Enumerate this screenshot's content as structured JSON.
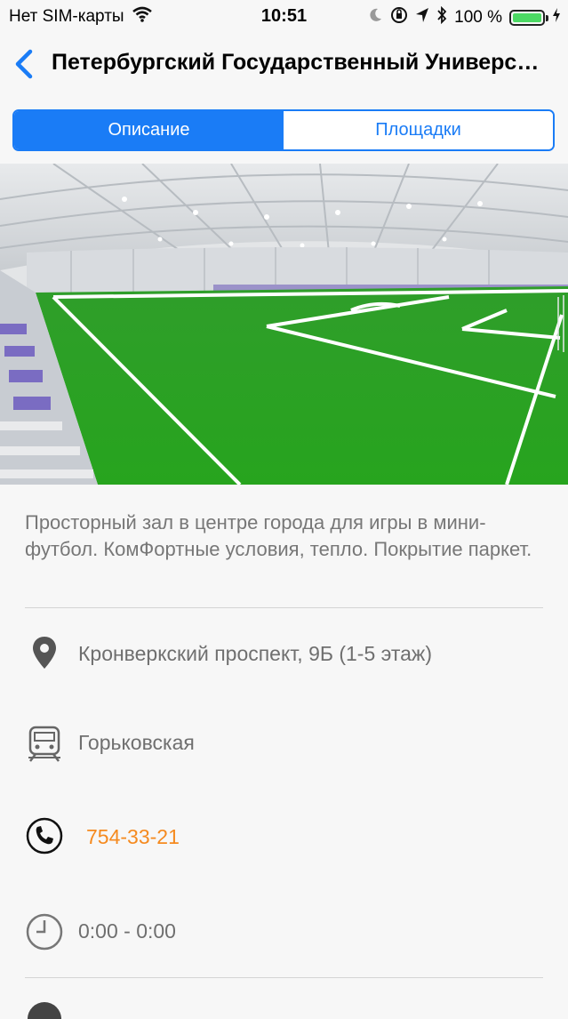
{
  "status_bar": {
    "carrier": "Нет SIM-карты",
    "time": "10:51",
    "battery": "100 %",
    "icons": [
      "wifi-icon",
      "moon-icon",
      "rotation-lock-icon",
      "location-arrow-icon",
      "bluetooth-icon",
      "battery-icon",
      "charging-icon"
    ]
  },
  "nav": {
    "title": "Петербургский Государственный Университет",
    "back_icon": "chevron-left-icon"
  },
  "tabs": [
    {
      "label": "Описание",
      "active": true
    },
    {
      "label": "Площадки",
      "active": false
    }
  ],
  "venue": {
    "description": "Просторный зал в центре города для игры в мини-футбол. КомФортные условия, тепло. Покрытие паркет.",
    "address": "Кронверкский проспект, 9Б (1-5 этаж)",
    "metro": "Горьковская",
    "phone": "754-33-21",
    "hours": "0:00 - 0:00"
  },
  "colors": {
    "accent": "#1a7cf6",
    "phone": "#f58a1f",
    "field_green": "#2f9e2a"
  }
}
